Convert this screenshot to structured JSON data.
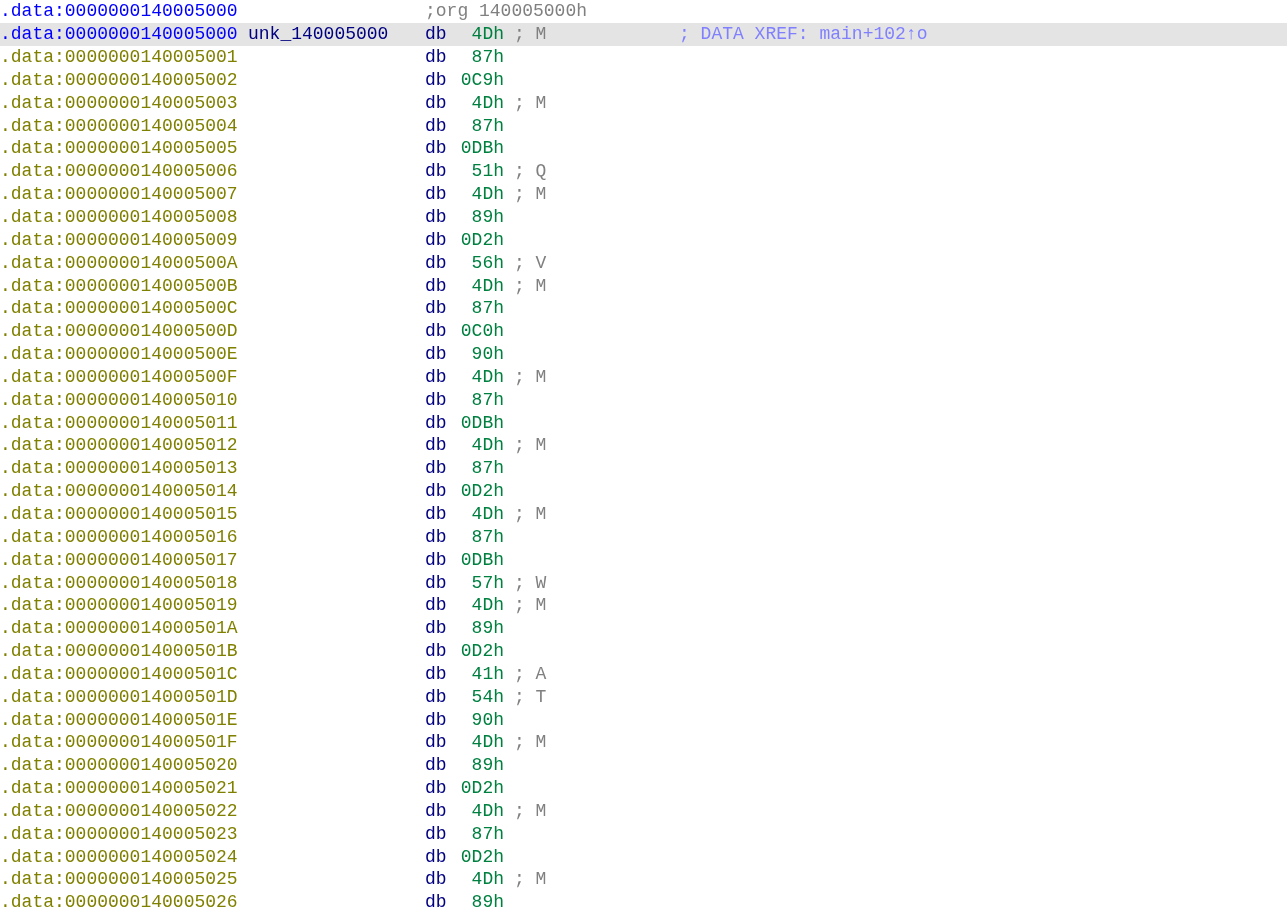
{
  "listing": [
    {
      "kind": "org",
      "selected": false,
      "address": ".data:0000000140005000",
      "directive": ";org 140005000h"
    },
    {
      "kind": "label",
      "selected": true,
      "address": ".data:0000000140005000",
      "label": "unk_140005000",
      "mnemonic": "db",
      "operand": "4Dh",
      "comment": "; M",
      "xref": "; DATA XREF: main+102↑o"
    },
    {
      "kind": "byte",
      "selected": false,
      "address": ".data:0000000140005001",
      "mnemonic": "db",
      "operand": "87h"
    },
    {
      "kind": "byte",
      "selected": false,
      "address": ".data:0000000140005002",
      "mnemonic": "db",
      "operand": "0C9h"
    },
    {
      "kind": "byte",
      "selected": false,
      "address": ".data:0000000140005003",
      "mnemonic": "db",
      "operand": "4Dh",
      "comment": "; M"
    },
    {
      "kind": "byte",
      "selected": false,
      "address": ".data:0000000140005004",
      "mnemonic": "db",
      "operand": "87h"
    },
    {
      "kind": "byte",
      "selected": false,
      "address": ".data:0000000140005005",
      "mnemonic": "db",
      "operand": "0DBh"
    },
    {
      "kind": "byte",
      "selected": false,
      "address": ".data:0000000140005006",
      "mnemonic": "db",
      "operand": "51h",
      "comment": "; Q"
    },
    {
      "kind": "byte",
      "selected": false,
      "address": ".data:0000000140005007",
      "mnemonic": "db",
      "operand": "4Dh",
      "comment": "; M"
    },
    {
      "kind": "byte",
      "selected": false,
      "address": ".data:0000000140005008",
      "mnemonic": "db",
      "operand": "89h"
    },
    {
      "kind": "byte",
      "selected": false,
      "address": ".data:0000000140005009",
      "mnemonic": "db",
      "operand": "0D2h"
    },
    {
      "kind": "byte",
      "selected": false,
      "address": ".data:000000014000500A",
      "mnemonic": "db",
      "operand": "56h",
      "comment": "; V"
    },
    {
      "kind": "byte",
      "selected": false,
      "address": ".data:000000014000500B",
      "mnemonic": "db",
      "operand": "4Dh",
      "comment": "; M"
    },
    {
      "kind": "byte",
      "selected": false,
      "address": ".data:000000014000500C",
      "mnemonic": "db",
      "operand": "87h"
    },
    {
      "kind": "byte",
      "selected": false,
      "address": ".data:000000014000500D",
      "mnemonic": "db",
      "operand": "0C0h"
    },
    {
      "kind": "byte",
      "selected": false,
      "address": ".data:000000014000500E",
      "mnemonic": "db",
      "operand": "90h"
    },
    {
      "kind": "byte",
      "selected": false,
      "address": ".data:000000014000500F",
      "mnemonic": "db",
      "operand": "4Dh",
      "comment": "; M"
    },
    {
      "kind": "byte",
      "selected": false,
      "address": ".data:0000000140005010",
      "mnemonic": "db",
      "operand": "87h"
    },
    {
      "kind": "byte",
      "selected": false,
      "address": ".data:0000000140005011",
      "mnemonic": "db",
      "operand": "0DBh"
    },
    {
      "kind": "byte",
      "selected": false,
      "address": ".data:0000000140005012",
      "mnemonic": "db",
      "operand": "4Dh",
      "comment": "; M"
    },
    {
      "kind": "byte",
      "selected": false,
      "address": ".data:0000000140005013",
      "mnemonic": "db",
      "operand": "87h"
    },
    {
      "kind": "byte",
      "selected": false,
      "address": ".data:0000000140005014",
      "mnemonic": "db",
      "operand": "0D2h"
    },
    {
      "kind": "byte",
      "selected": false,
      "address": ".data:0000000140005015",
      "mnemonic": "db",
      "operand": "4Dh",
      "comment": "; M"
    },
    {
      "kind": "byte",
      "selected": false,
      "address": ".data:0000000140005016",
      "mnemonic": "db",
      "operand": "87h"
    },
    {
      "kind": "byte",
      "selected": false,
      "address": ".data:0000000140005017",
      "mnemonic": "db",
      "operand": "0DBh"
    },
    {
      "kind": "byte",
      "selected": false,
      "address": ".data:0000000140005018",
      "mnemonic": "db",
      "operand": "57h",
      "comment": "; W"
    },
    {
      "kind": "byte",
      "selected": false,
      "address": ".data:0000000140005019",
      "mnemonic": "db",
      "operand": "4Dh",
      "comment": "; M"
    },
    {
      "kind": "byte",
      "selected": false,
      "address": ".data:000000014000501A",
      "mnemonic": "db",
      "operand": "89h"
    },
    {
      "kind": "byte",
      "selected": false,
      "address": ".data:000000014000501B",
      "mnemonic": "db",
      "operand": "0D2h"
    },
    {
      "kind": "byte",
      "selected": false,
      "address": ".data:000000014000501C",
      "mnemonic": "db",
      "operand": "41h",
      "comment": "; A"
    },
    {
      "kind": "byte",
      "selected": false,
      "address": ".data:000000014000501D",
      "mnemonic": "db",
      "operand": "54h",
      "comment": "; T"
    },
    {
      "kind": "byte",
      "selected": false,
      "address": ".data:000000014000501E",
      "mnemonic": "db",
      "operand": "90h"
    },
    {
      "kind": "byte",
      "selected": false,
      "address": ".data:000000014000501F",
      "mnemonic": "db",
      "operand": "4Dh",
      "comment": "; M"
    },
    {
      "kind": "byte",
      "selected": false,
      "address": ".data:0000000140005020",
      "mnemonic": "db",
      "operand": "89h"
    },
    {
      "kind": "byte",
      "selected": false,
      "address": ".data:0000000140005021",
      "mnemonic": "db",
      "operand": "0D2h"
    },
    {
      "kind": "byte",
      "selected": false,
      "address": ".data:0000000140005022",
      "mnemonic": "db",
      "operand": "4Dh",
      "comment": "; M"
    },
    {
      "kind": "byte",
      "selected": false,
      "address": ".data:0000000140005023",
      "mnemonic": "db",
      "operand": "87h"
    },
    {
      "kind": "byte",
      "selected": false,
      "address": ".data:0000000140005024",
      "mnemonic": "db",
      "operand": "0D2h"
    },
    {
      "kind": "byte",
      "selected": false,
      "address": ".data:0000000140005025",
      "mnemonic": "db",
      "operand": "4Dh",
      "comment": "; M"
    },
    {
      "kind": "byte",
      "selected": false,
      "address": ".data:0000000140005026",
      "mnemonic": "db",
      "operand": "89h"
    }
  ]
}
